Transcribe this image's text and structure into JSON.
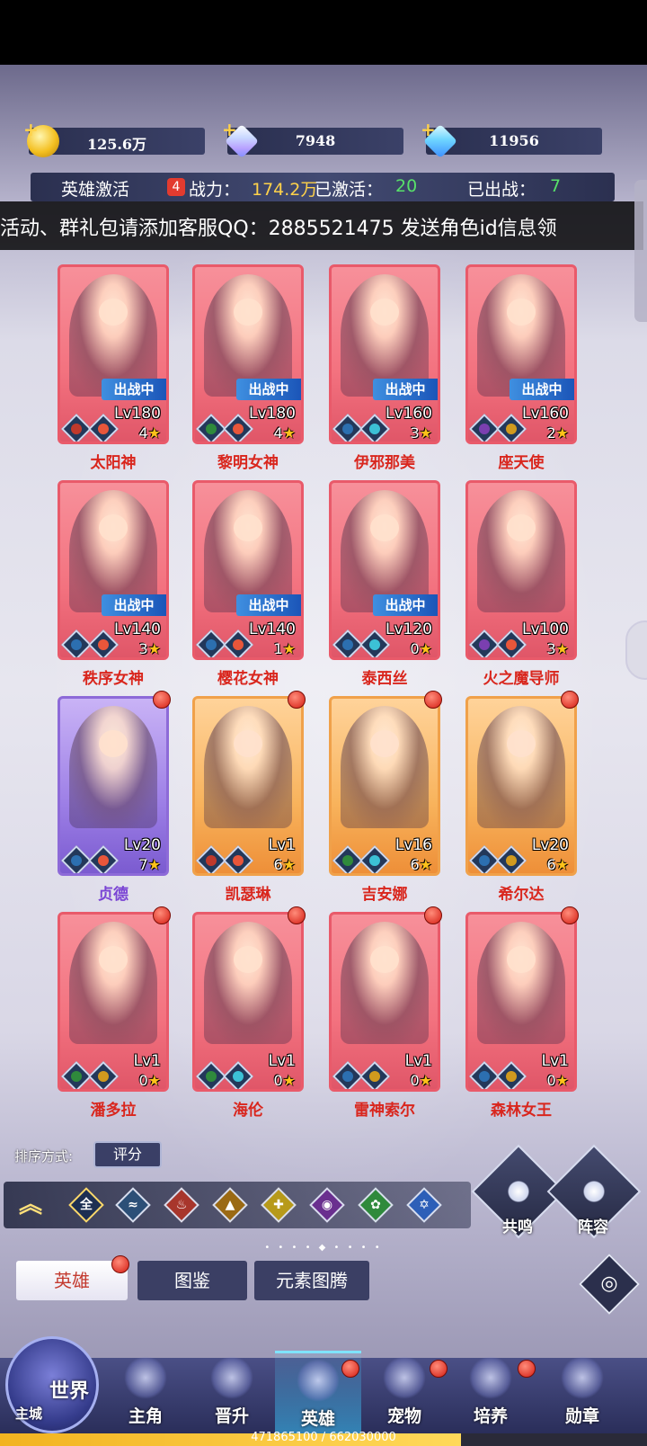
{
  "resources": {
    "gold": "125.6万",
    "crystal": "7948",
    "diamond": "11956"
  },
  "stats": {
    "activate_label": "英雄激活",
    "activate_badge": "4",
    "power_label": "战力：",
    "power_value": "174.2万",
    "activated_label": "已激活：",
    "activated_value": "20",
    "deployed_label": "已出战：",
    "deployed_value": "7"
  },
  "marquee": "活动、群礼包请添加客服QQ：2885521475 发送角色id信息领",
  "heroes": [
    {
      "name": "太阳神",
      "level": "Lv180",
      "stars": "4",
      "in_battle": "出战中"
    },
    {
      "name": "黎明女神",
      "level": "Lv180",
      "stars": "4",
      "in_battle": "出战中"
    },
    {
      "name": "伊邪那美",
      "level": "Lv160",
      "stars": "3",
      "in_battle": "出战中"
    },
    {
      "name": "座天使",
      "level": "Lv160",
      "stars": "2",
      "in_battle": "出战中"
    },
    {
      "name": "秩序女神",
      "level": "Lv140",
      "stars": "3",
      "in_battle": "出战中"
    },
    {
      "name": "樱花女神",
      "level": "Lv140",
      "stars": "1",
      "in_battle": "出战中"
    },
    {
      "name": "泰西丝",
      "level": "Lv120",
      "stars": "0",
      "in_battle": "出战中"
    },
    {
      "name": "火之魔导师",
      "level": "Lv100",
      "stars": "3"
    },
    {
      "name": "贞德",
      "level": "Lv20",
      "stars": "7"
    },
    {
      "name": "凯瑟琳",
      "level": "Lv1",
      "stars": "6"
    },
    {
      "name": "吉安娜",
      "level": "Lv16",
      "stars": "6"
    },
    {
      "name": "希尔达",
      "level": "Lv20",
      "stars": "6"
    },
    {
      "name": "潘多拉",
      "level": "Lv1",
      "stars": "0"
    },
    {
      "name": "海伦",
      "level": "Lv1",
      "stars": "0"
    },
    {
      "name": "雷神索尔",
      "level": "Lv1",
      "stars": "0"
    },
    {
      "name": "森林女王",
      "level": "Lv1",
      "stars": "0"
    }
  ],
  "sort": {
    "label": "排序方式:",
    "value": "评分"
  },
  "filters": {
    "all": "全",
    "elements": [
      "water-icon",
      "fire-icon",
      "earth-icon",
      "light-icon",
      "dark-icon",
      "wind-icon",
      "star-icon"
    ]
  },
  "actions": {
    "resonance": "共鸣",
    "lineup": "阵容"
  },
  "tabs": {
    "hero": "英雄",
    "atlas": "图鉴",
    "totem": "元素图腾"
  },
  "nav": {
    "world": "世界",
    "main_city": "主城",
    "protagonist": "主角",
    "promote": "晋升",
    "hero": "英雄",
    "pet": "宠物",
    "cultivate": "培养",
    "medal": "勋章"
  },
  "progress": {
    "text": "471865100 / 662030000",
    "value": 0.7128
  },
  "colors": {
    "accent_gold": "#ffd24a",
    "accent_green": "#58e06a",
    "card_red": "#f3727f",
    "card_orange": "#f8b35c",
    "card_purple": "#9d7fe6",
    "name_red": "#d9261d"
  }
}
